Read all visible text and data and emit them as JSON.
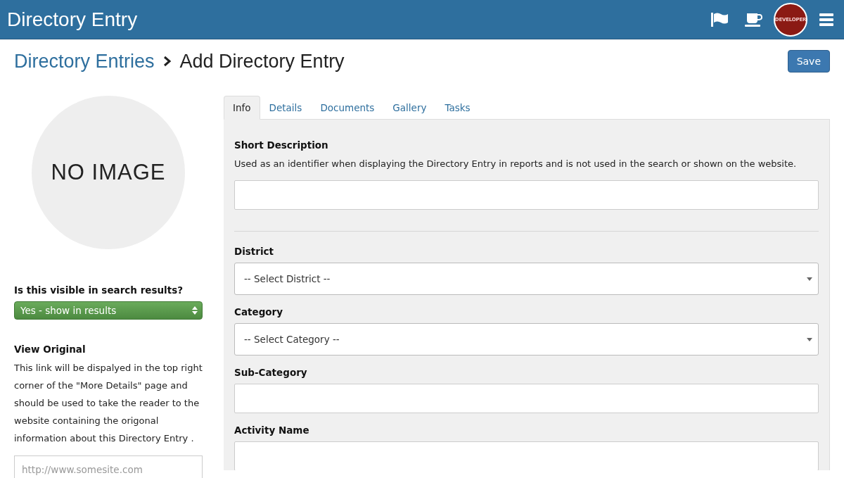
{
  "header": {
    "title": "Directory Entry",
    "avatar_label": "DEVELOPER"
  },
  "breadcrumb": {
    "parent": "Directory Entries",
    "current": "Add Directory Entry"
  },
  "save_button": "Save",
  "image_placeholder": "NO IMAGE",
  "visibility": {
    "label": "Is this visible in search results?",
    "value": "Yes - show in results"
  },
  "view_original": {
    "label": "View Original",
    "help": "This link will be dispalyed in the top right corner of the \"More Details\" page and should be used to take the reader to the website containing the origonal information about this Directory Entry .",
    "placeholder": "http://www.somesite.com"
  },
  "tabs": [
    {
      "label": "Info",
      "selected": true
    },
    {
      "label": "Details",
      "selected": false
    },
    {
      "label": "Documents",
      "selected": false
    },
    {
      "label": "Gallery",
      "selected": false
    },
    {
      "label": "Tasks",
      "selected": false
    }
  ],
  "fields": [
    {
      "kind": "text",
      "label": "Short Description",
      "help": "Used as an identifier when displaying the Directory Entry in reports and is not used in the search or shown on the website.",
      "divider_after": true
    },
    {
      "kind": "select",
      "label": "District",
      "value": "-- Select District --",
      "divider_after": false
    },
    {
      "kind": "select",
      "label": "Category",
      "value": "-- Select Category --",
      "divider_after": false
    },
    {
      "kind": "text",
      "label": "Sub-Category",
      "divider_after": false
    },
    {
      "kind": "text",
      "label": "Activity Name",
      "divider_after": false
    }
  ]
}
